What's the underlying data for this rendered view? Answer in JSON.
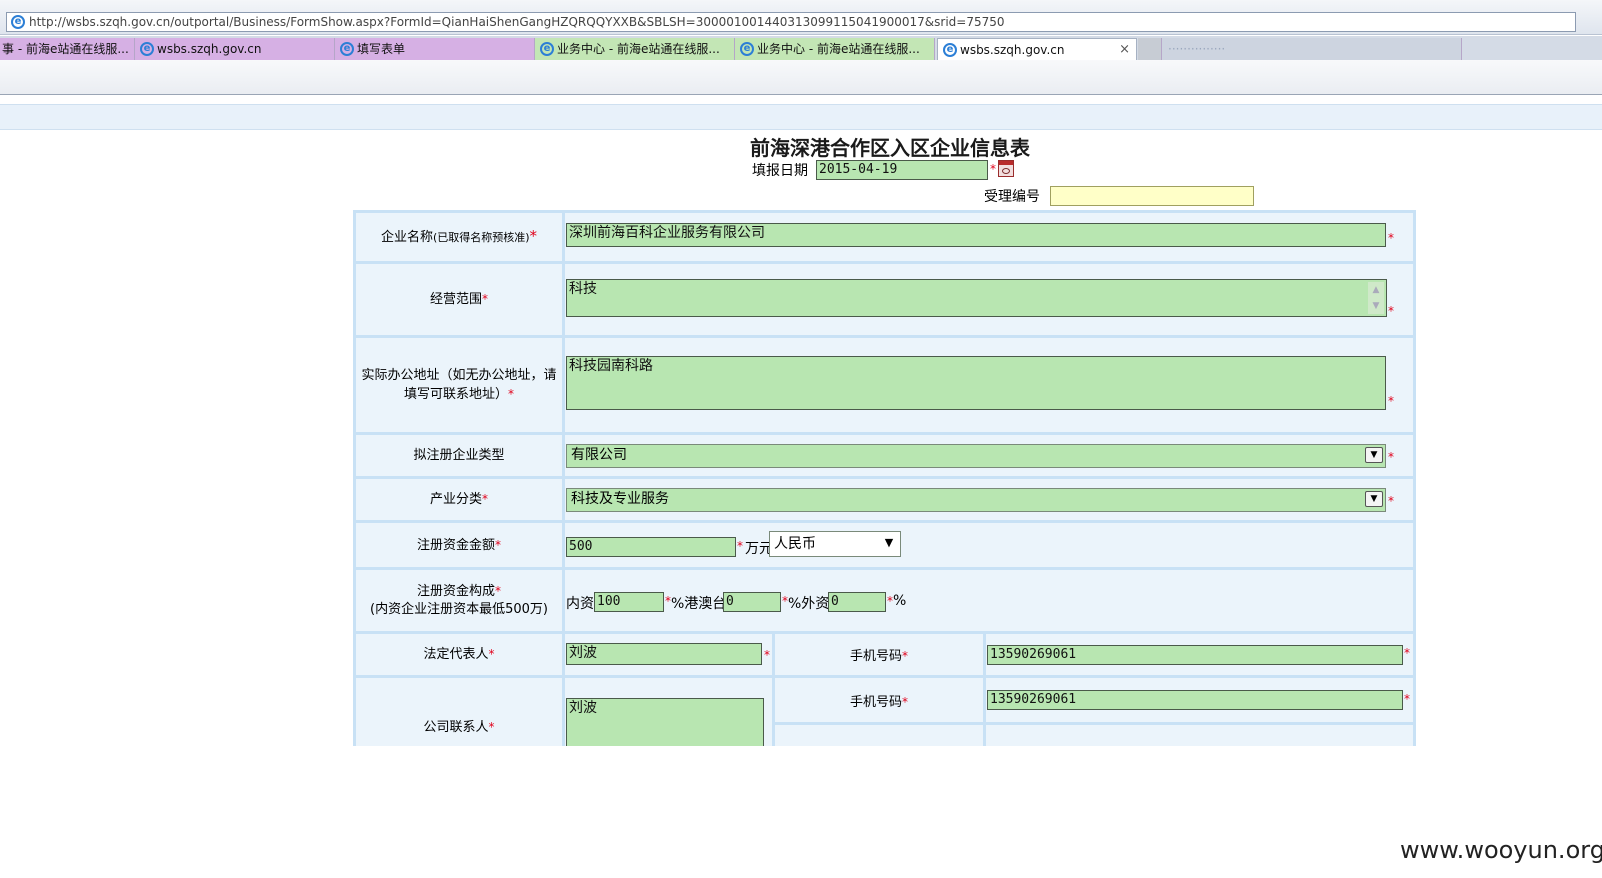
{
  "browser": {
    "url": "http://wsbs.szqh.gov.cn/outportal/Business/FormShow.aspx?FormId=QianHaiShenGangHZQRQQYXXB&SBLSH=300001001440313099115041900017&srid=75750",
    "tabs": [
      {
        "label": "事 - 前海e站通在线服..."
      },
      {
        "label": "wsbs.szqh.gov.cn"
      },
      {
        "label": "填写表单"
      },
      {
        "label": "业务中心 - 前海e站通在线服..."
      },
      {
        "label": "业务中心 - 前海e站通在线服..."
      },
      {
        "label": "wsbs.szqh.gov.cn"
      }
    ],
    "close_glyph": "×",
    "blurred_tab": "···············"
  },
  "form": {
    "title": "前海深港合作区入区企业信息表",
    "fill_date_label": "填报日期",
    "fill_date_value": "2015-04-19",
    "accept_no_label": "受理编号",
    "accept_no_value": "",
    "required_mark": "*",
    "company_name": {
      "label": "企业名称",
      "hint": "(已取得名称预核准)",
      "value": "深圳前海百科企业服务有限公司"
    },
    "business_scope": {
      "label": "经营范围",
      "value": "科技"
    },
    "office_address": {
      "label": "实际办公地址（如无办公地址，请填写可联系地址）",
      "value": "科技园南科路"
    },
    "company_type": {
      "label": "拟注册企业类型",
      "value": "有限公司"
    },
    "industry": {
      "label": "产业分类",
      "value": "科技及专业服务"
    },
    "capital": {
      "label": "注册资金金额",
      "value": "500",
      "unit": "万元",
      "currency": "人民币"
    },
    "capital_structure": {
      "label": "注册资金构成",
      "note": "(内资企业注册资本最低500万)",
      "domestic_label": "内资",
      "domestic_value": "100",
      "hk_label": "%港澳台",
      "hk_value": "0",
      "foreign_label": "%外资",
      "foreign_value": "0",
      "percent": "%"
    },
    "legal_rep": {
      "label": "法定代表人",
      "value": "刘波",
      "phone_label": "手机号码",
      "phone_value": "13590269061"
    },
    "contact": {
      "label": "公司联系人",
      "value": "刘波",
      "phone_label": "手机号码",
      "phone_value": "13590269061"
    }
  },
  "watermark": "www.wooyun.org",
  "colors": {
    "field_bg": "#b8e6b1",
    "cell_bg": "#ebf4fb",
    "required": "#e0001a",
    "accept_bg": "#ffffc8"
  }
}
